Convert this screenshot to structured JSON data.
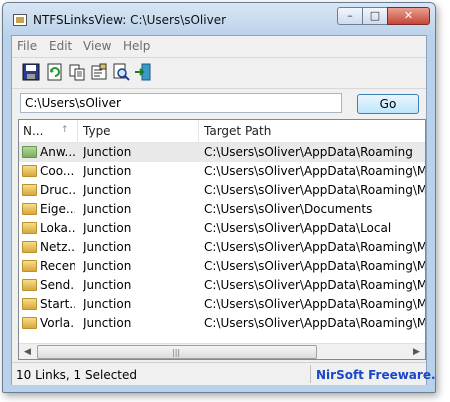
{
  "window": {
    "title": "NTFSLinksView:  C:\\Users\\sOliver",
    "minimize_glyph": "–",
    "maximize_glyph": "□",
    "close_glyph": "✕"
  },
  "menu": [
    "File",
    "Edit",
    "View",
    "Help"
  ],
  "toolbar": {
    "icons": [
      "save-icon",
      "refresh-icon",
      "copy-icon",
      "properties-icon",
      "find-icon",
      "exit-icon"
    ]
  },
  "path_bar": {
    "value": "C:\\Users\\sOliver",
    "go_label": "Go"
  },
  "list": {
    "columns": [
      "N...",
      "Type",
      "Target Path"
    ],
    "sort_indicator": "↑",
    "rows": [
      {
        "name": "Anw...",
        "type": "Junction",
        "path": "C:\\Users\\sOliver\\AppData\\Roaming",
        "selected": true,
        "icon": "green-folder-icon"
      },
      {
        "name": "Coo...",
        "type": "Junction",
        "path": "C:\\Users\\sOliver\\AppData\\Roaming\\Micro",
        "selected": false,
        "icon": "folder-icon"
      },
      {
        "name": "Druc...",
        "type": "Junction",
        "path": "C:\\Users\\sOliver\\AppData\\Roaming\\Micro",
        "selected": false,
        "icon": "folder-icon"
      },
      {
        "name": "Eige...",
        "type": "Junction",
        "path": "C:\\Users\\sOliver\\Documents",
        "selected": false,
        "icon": "folder-icon"
      },
      {
        "name": "Loka...",
        "type": "Junction",
        "path": "C:\\Users\\sOliver\\AppData\\Local",
        "selected": false,
        "icon": "folder-icon"
      },
      {
        "name": "Netz...",
        "type": "Junction",
        "path": "C:\\Users\\sOliver\\AppData\\Roaming\\Micro",
        "selected": false,
        "icon": "folder-icon"
      },
      {
        "name": "Recent",
        "type": "Junction",
        "path": "C:\\Users\\sOliver\\AppData\\Roaming\\Micro",
        "selected": false,
        "icon": "folder-icon"
      },
      {
        "name": "Send...",
        "type": "Junction",
        "path": "C:\\Users\\sOliver\\AppData\\Roaming\\Micro",
        "selected": false,
        "icon": "folder-icon"
      },
      {
        "name": "Start...",
        "type": "Junction",
        "path": "C:\\Users\\sOliver\\AppData\\Roaming\\Micro",
        "selected": false,
        "icon": "folder-icon"
      },
      {
        "name": "Vorla...",
        "type": "Junction",
        "path": "C:\\Users\\sOliver\\AppData\\Roaming\\Micro",
        "selected": false,
        "icon": "folder-icon"
      }
    ]
  },
  "scrollbar": {
    "left_arrow": "◀",
    "right_arrow": "▶",
    "grip": "|||"
  },
  "status": {
    "summary": "10 Links, 1 Selected",
    "credit": "NirSoft Freeware.  h"
  },
  "colors": {
    "window_frame": "#b9d1ea",
    "close_button": "#c6463a",
    "credit_text": "#1947c8",
    "selected_row": "#e9e9e9"
  }
}
